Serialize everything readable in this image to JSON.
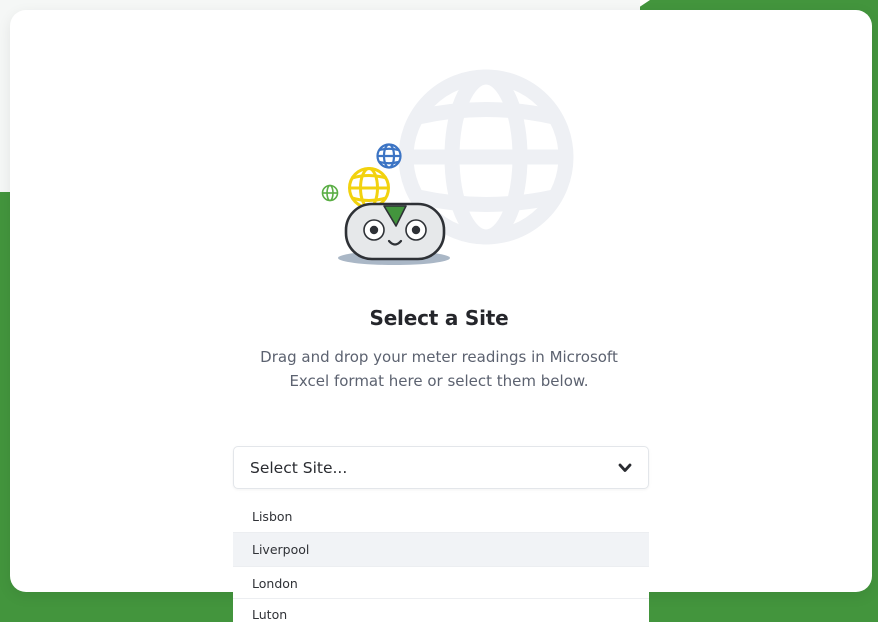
{
  "colors": {
    "brand_green": "#43953d",
    "card": "#ffffff",
    "title": "#25262b",
    "subtitle": "#5c6270",
    "globe_blue": "#3c74c4",
    "globe_yellow": "#f2d20e",
    "globe_green": "#5aae45",
    "mascot_body": "#e6e8ea",
    "mascot_leaf": "#43953d",
    "option_hover": "#f1f3f6"
  },
  "icons": {
    "illustration": "mascot-with-globes",
    "background_globe": "globe-icon",
    "select_chevron": "chevron-down-icon"
  },
  "main": {
    "title": "Select a Site",
    "subtitle_line1": "Drag and drop your meter readings in Microsoft",
    "subtitle_line2": "Excel format here or select them below."
  },
  "site_select": {
    "selected": "Select Site...",
    "options": [
      {
        "label": "Lisbon",
        "highlighted": false
      },
      {
        "label": "Liverpool",
        "highlighted": true
      },
      {
        "label": "London",
        "highlighted": false
      },
      {
        "label": "Luton",
        "highlighted": false
      }
    ]
  }
}
